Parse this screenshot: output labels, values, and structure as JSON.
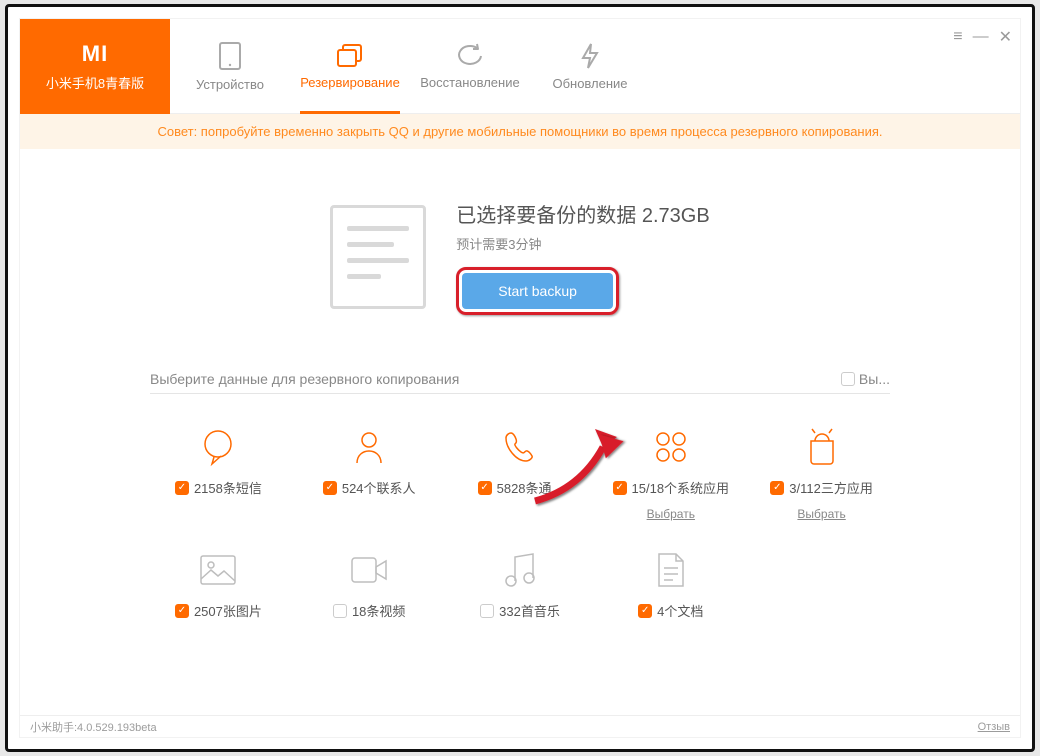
{
  "brand": {
    "logo_text": "MI",
    "device_name": "小米手机8青春版"
  },
  "tabs": {
    "device": "Устройство",
    "backup": "Резервирование",
    "restore": "Восстановление",
    "update": "Обновление"
  },
  "window_controls": {
    "menu": "≡",
    "minimize": "—",
    "close": "✕"
  },
  "tip": "Совет: попробуйте временно закрыть QQ и другие мобильные помощники во время процесса резервного копирования.",
  "summary": {
    "title": "已选择要备份的数据 2.73GB",
    "eta": "预计需要3分钟",
    "start_label": "Start backup"
  },
  "selector": {
    "prompt": "Выберите данные для резервного копирования",
    "select_all": "Вы..."
  },
  "categories": [
    {
      "key": "sms",
      "label": "2158条短信",
      "checked": true,
      "select_link": ""
    },
    {
      "key": "contacts",
      "label": "524个联系人",
      "checked": true,
      "select_link": ""
    },
    {
      "key": "calls",
      "label": "5828条通...",
      "checked": true,
      "select_link": ""
    },
    {
      "key": "sysapps",
      "label": "15/18个系统应用",
      "checked": true,
      "select_link": "Выбрать"
    },
    {
      "key": "userapps",
      "label": "3/112三方应用",
      "checked": true,
      "select_link": "Выбрать"
    },
    {
      "key": "photos",
      "label": "2507张图片",
      "checked": true,
      "select_link": ""
    },
    {
      "key": "videos",
      "label": "18条视频",
      "checked": false,
      "select_link": ""
    },
    {
      "key": "music",
      "label": "332首音乐",
      "checked": false,
      "select_link": ""
    },
    {
      "key": "docs",
      "label": "4个文档",
      "checked": true,
      "select_link": ""
    }
  ],
  "footer": {
    "version": "小米助手:4.0.529.193beta",
    "feedback": "Отзыв"
  }
}
